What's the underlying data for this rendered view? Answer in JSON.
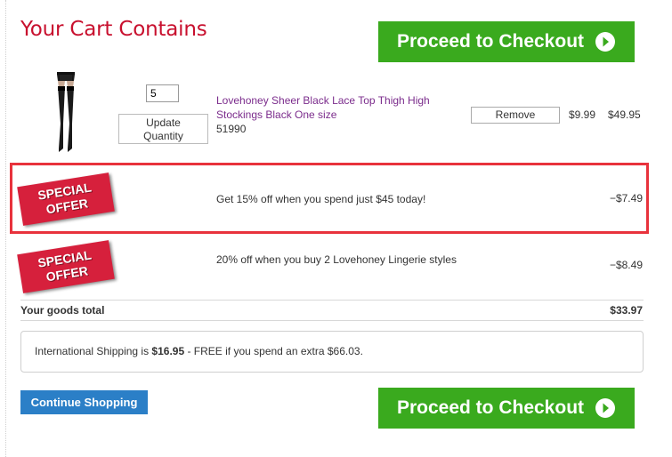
{
  "cart": {
    "title": "Your Cart Contains"
  },
  "checkout": {
    "label": "Proceed to Checkout",
    "icon": "arrow-right-circle-icon",
    "color": "#3aaa1e"
  },
  "item": {
    "quantity": "5",
    "update_label_line1": "Update",
    "update_label_line2": "Quantity",
    "name": "Lovehoney Sheer Black Lace Top Thigh High Stockings Black One size",
    "code": "51990",
    "remove_label": "Remove",
    "unit_price": "$9.99",
    "line_price": "$49.95",
    "name_color": "#7b2c8c"
  },
  "offers": [
    {
      "badge_line1": "SPECIAL",
      "badge_line2": "OFFER",
      "text": "Get 15% off when you spend just $45 today!",
      "amount": "−$7.49"
    },
    {
      "badge_line1": "SPECIAL",
      "badge_line2": "OFFER",
      "text": "20% off when you buy 2 Lovehoney Lingerie styles",
      "amount": "−$8.49"
    }
  ],
  "totals": {
    "goods_label": "Your goods total",
    "goods_total": "$33.97"
  },
  "shipping": {
    "prefix": "International Shipping is ",
    "amount": "$16.95",
    "suffix": " - FREE if you spend an extra $66.03."
  },
  "continue": {
    "label": "Continue Shopping",
    "color": "#2b7fc7"
  },
  "colors": {
    "title": "#c8102e",
    "badge": "#d6203c",
    "highlight": "#e8323c"
  }
}
